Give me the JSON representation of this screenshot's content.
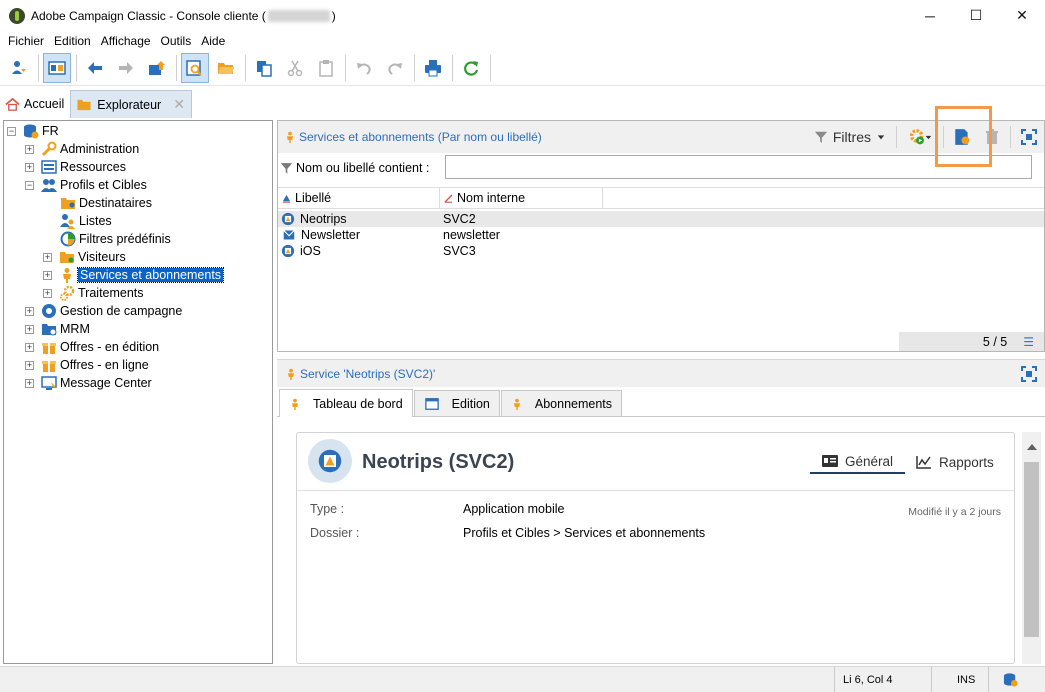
{
  "window": {
    "title_prefix": "Adobe Campaign Classic - Console cliente (",
    "title_suffix": ")",
    "minimize": "─",
    "maximize": "☐",
    "close": "✕"
  },
  "menu": [
    "Fichier",
    "Edition",
    "Affichage",
    "Outils",
    "Aide"
  ],
  "tabs": {
    "home": "Accueil",
    "explorer": "Explorateur",
    "close": "✕"
  },
  "tree": {
    "root": "FR",
    "items": [
      {
        "label": "Administration",
        "expander": "+"
      },
      {
        "label": "Ressources",
        "expander": "+"
      },
      {
        "label": "Profils et Cibles",
        "expander": "−"
      },
      {
        "label": "Destinataires",
        "expander": ""
      },
      {
        "label": "Listes",
        "expander": ""
      },
      {
        "label": "Filtres prédéfinis",
        "expander": ""
      },
      {
        "label": "Visiteurs",
        "expander": "+"
      },
      {
        "label": "Services et abonnements",
        "expander": "+"
      },
      {
        "label": "Traitements",
        "expander": "+"
      },
      {
        "label": "Gestion de campagne",
        "expander": "+"
      },
      {
        "label": "MRM",
        "expander": "+"
      },
      {
        "label": "Offres - en édition",
        "expander": "+"
      },
      {
        "label": "Offres - en ligne",
        "expander": "+"
      },
      {
        "label": "Message Center",
        "expander": "+"
      }
    ]
  },
  "list_panel": {
    "title": "Services et abonnements (Par nom ou libellé)",
    "filters_label": "Filtres",
    "filter_label": "Nom ou libellé contient :",
    "filter_value": "",
    "columns": [
      "Libellé",
      "Nom interne"
    ],
    "rows": [
      {
        "label": "Neotrips",
        "name": "SVC2"
      },
      {
        "label": "Newsletter",
        "name": "newsletter"
      },
      {
        "label": "iOS",
        "name": "SVC3"
      }
    ],
    "counter": "5 / 5"
  },
  "detail": {
    "header": "Service 'Neotrips (SVC2)'",
    "tabs": [
      "Tableau de bord",
      "Edition",
      "Abonnements"
    ],
    "title": "Neotrips (SVC2)",
    "view_tabs": [
      "Général",
      "Rapports"
    ],
    "type_key": "Type :",
    "type_value": "Application mobile",
    "folder_key": "Dossier :",
    "folder_value": "Profils et Cibles > Services et abonnements",
    "modified": "Modifié il y a 2 jours"
  },
  "status": {
    "position": "Li 6, Col 4",
    "mode": "INS"
  },
  "colors": {
    "accent": "#2a6fba",
    "selection": "#0a64c8",
    "highlight": "#f39a4a",
    "orange_icon": "#f0a020"
  }
}
